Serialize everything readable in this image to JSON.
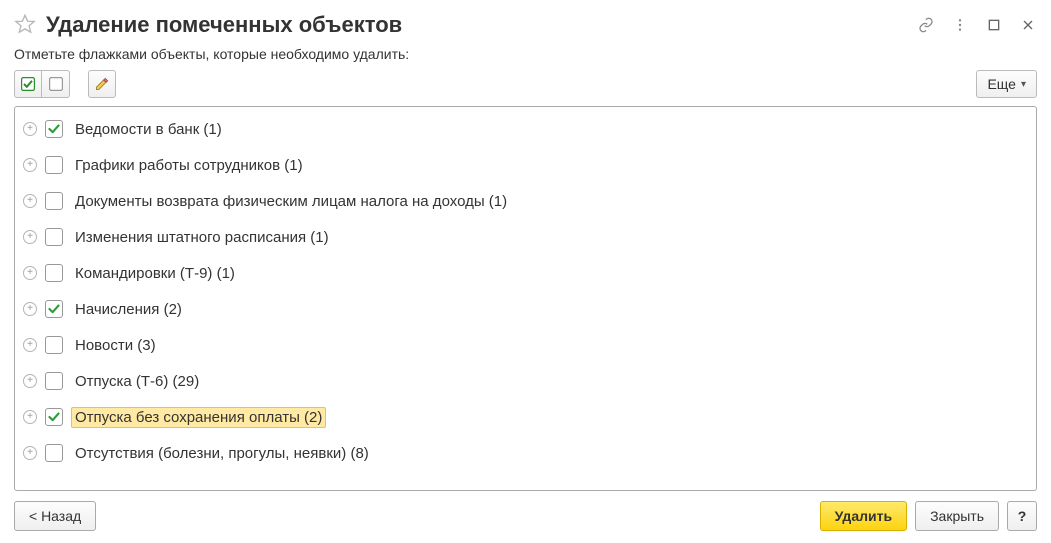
{
  "title": "Удаление помеченных объектов",
  "subtitle": "Отметьте флажками объекты, которые необходимо удалить:",
  "toolbar": {
    "more_label": "Еще"
  },
  "tree": {
    "items": [
      {
        "label": "Ведомости в банк (1)",
        "checked": true,
        "selected": false
      },
      {
        "label": "Графики работы сотрудников (1)",
        "checked": false,
        "selected": false
      },
      {
        "label": "Документы возврата физическим лицам налога на доходы (1)",
        "checked": false,
        "selected": false
      },
      {
        "label": "Изменения штатного расписания (1)",
        "checked": false,
        "selected": false
      },
      {
        "label": "Командировки (Т-9) (1)",
        "checked": false,
        "selected": false
      },
      {
        "label": "Начисления (2)",
        "checked": true,
        "selected": false
      },
      {
        "label": "Новости (3)",
        "checked": false,
        "selected": false
      },
      {
        "label": "Отпуска (Т-6) (29)",
        "checked": false,
        "selected": false
      },
      {
        "label": "Отпуска без сохранения оплаты (2)",
        "checked": true,
        "selected": true
      },
      {
        "label": "Отсутствия (болезни, прогулы, неявки) (8)",
        "checked": false,
        "selected": false
      }
    ]
  },
  "footer": {
    "back_label": "< Назад",
    "delete_label": "Удалить",
    "close_label": "Закрыть",
    "help_label": "?"
  }
}
